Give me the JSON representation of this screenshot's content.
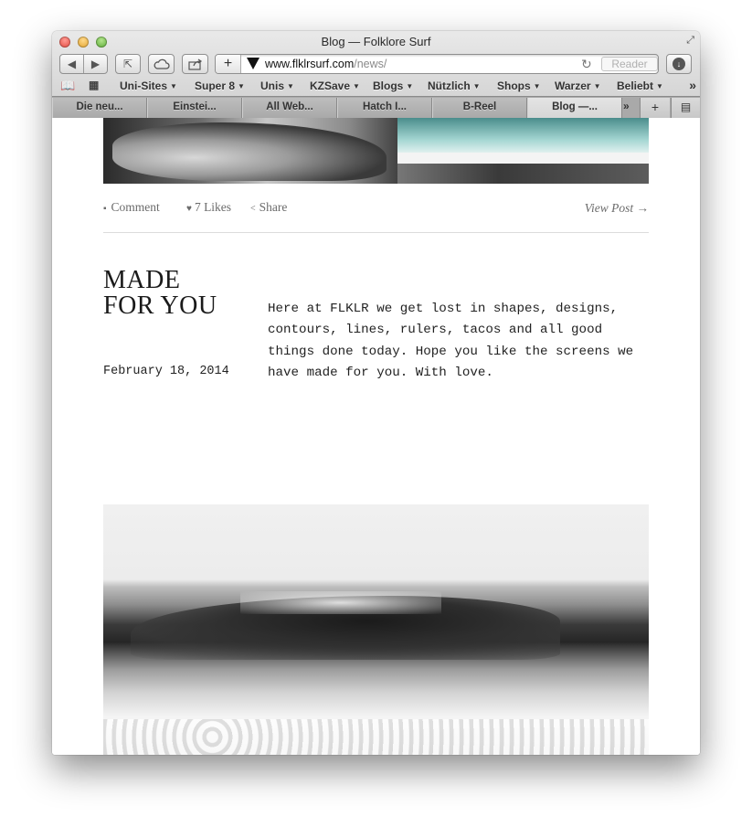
{
  "window": {
    "title": "Blog — Folklore Surf"
  },
  "toolbar": {
    "url_domain": "www.flklrsurf.com",
    "url_path": "/news/",
    "reader_label": "Reader"
  },
  "bookmarks": [
    {
      "label": "Uni-Sites"
    },
    {
      "label": "Super 8"
    },
    {
      "label": "Unis"
    },
    {
      "label": "KZSave"
    },
    {
      "label": "Blogs"
    },
    {
      "label": "Nützlich"
    },
    {
      "label": "Shops"
    },
    {
      "label": "Warzer"
    },
    {
      "label": "Beliebt"
    }
  ],
  "tabs": [
    {
      "label": "Die neu..."
    },
    {
      "label": "Einstei..."
    },
    {
      "label": "All Web..."
    },
    {
      "label": "Hatch I..."
    },
    {
      "label": "B-Reel"
    },
    {
      "label": "Blog —..."
    }
  ],
  "post_meta": {
    "comment": "Comment",
    "likes": "7 Likes",
    "share": "Share",
    "view_post": "View Post →"
  },
  "post": {
    "title_line1": "MADE",
    "title_line2": "FOR YOU",
    "date": "February 18, 2014",
    "body": "Here at FLKLR we get lost in shapes, designs, contours, lines, rulers, tacos and all good things done today. Hope you like the screens we have made for you. With love."
  },
  "icons": {
    "comment": "speech-bubble-icon",
    "likes": "heart-icon",
    "share": "share-icon"
  }
}
